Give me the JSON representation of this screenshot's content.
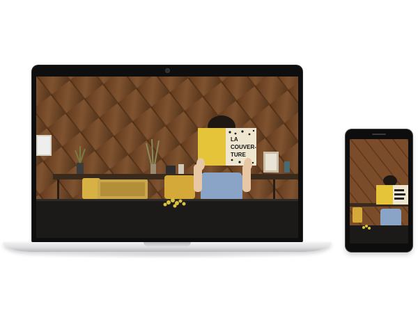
{
  "photo": {
    "book_title_lines": [
      "LA",
      "COUVER-",
      "TURE"
    ],
    "colors": {
      "wood": "#7a4c2a",
      "table": "#1c1a18",
      "book": "#e6c43a",
      "shirt": "#8aa4c8"
    }
  },
  "devices": {
    "laptop_icon": "laptop-icon",
    "phone_icon": "smartphone-icon"
  }
}
